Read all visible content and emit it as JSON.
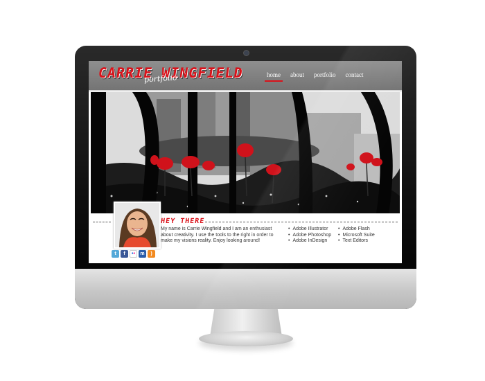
{
  "site": {
    "logo": "CARRIE WINGFIELD",
    "logo_sub": "portfolio"
  },
  "nav": {
    "items": [
      "home",
      "about",
      "portfolio",
      "contact"
    ],
    "active": "home"
  },
  "intro": {
    "heading": "HEY THERE",
    "text": "My name is Carrie Wingfield and I am an enthusiast about creativity.  I use the tools to the right in order to make my visions reality. Enjoy looking around!"
  },
  "skills": {
    "col1": [
      "Adobe Illustrator",
      "Adobe Photoshop",
      "Adobe InDesign"
    ],
    "col2": [
      "Adobe Flash",
      "Microsoft Suite",
      "Text Editors"
    ]
  },
  "social_icons": [
    "twitter-icon",
    "facebook-icon",
    "flickr-icon",
    "myspace-icon",
    "rss-icon"
  ],
  "colors": {
    "accent": "#d9121a",
    "header": "#7f7f7f",
    "twitter": "#54a8d8",
    "facebook": "#3b5998",
    "flickr": "#ffffff",
    "myspace": "#2a5ca8",
    "rss": "#f28a20"
  }
}
